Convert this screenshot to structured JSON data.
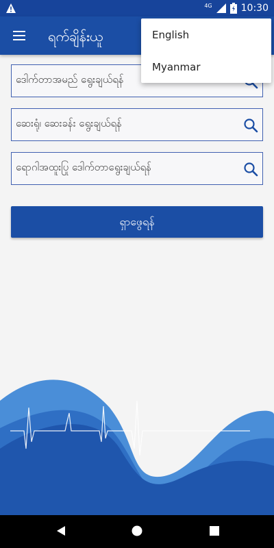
{
  "status_bar": {
    "network": "4G",
    "time": "10:30",
    "warning_icon": "warning-triangle-icon",
    "signal_icon": "signal-icon",
    "battery_icon": "battery-icon"
  },
  "app_bar": {
    "title": "ရက်ချိန်းယူ",
    "menu_icon": "hamburger-menu-icon"
  },
  "search_fields": {
    "doctor": {
      "placeholder": "ဒေါက်တာအမည် ရွေးချယ်ရန်"
    },
    "hospital": {
      "placeholder": "ဆေးရုံ၊ ဆေးခန်း ရွေးချယ်ရန်"
    },
    "specialty": {
      "placeholder": "ရောဂါအထူးပြု ဒေါက်တာရွေးချယ်ရန်"
    }
  },
  "search_button": {
    "label": "ရှာဖွေရန်"
  },
  "language_menu": {
    "items": [
      "English",
      "Myanmar"
    ]
  },
  "colors": {
    "primary": "#1b4ea5",
    "status_bar": "#17449b",
    "wave_light": "#4a8ed8",
    "wave_mid": "#2f6fc4",
    "wave_dark": "#1f56ad"
  },
  "nav_bar": {
    "back_icon": "back-triangle-icon",
    "home_icon": "home-circle-icon",
    "recents_icon": "recents-square-icon"
  }
}
